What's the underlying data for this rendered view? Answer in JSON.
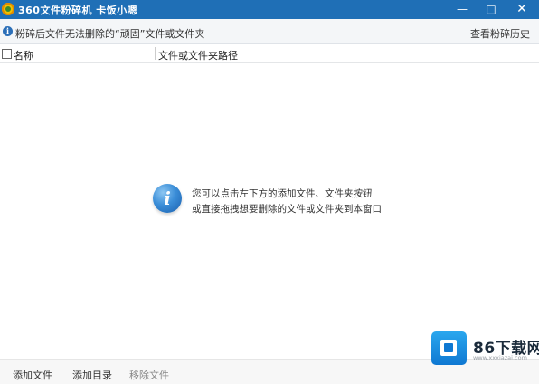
{
  "window": {
    "title": "360文件粉碎机  卡饭小嗯",
    "minimize_glyph": "—",
    "maximize_glyph": "□",
    "close_glyph": "✕",
    "logo_icon": "360-logo-icon"
  },
  "info_bar": {
    "icon": "info-icon",
    "text": "粉碎后文件无法删除的“顽固”文件或文件夹",
    "history_link": "查看粉碎历史"
  },
  "table": {
    "columns": [
      "名称",
      "文件或文件夹路径"
    ],
    "rows": []
  },
  "empty_state": {
    "icon_glyph": "i",
    "line1": "您可以点击左下方的添加文件、文件夹按钮",
    "line2": "或直接拖拽想要删除的文件或文件夹到本窗口"
  },
  "bottom_bar": {
    "add_file": "添加文件",
    "add_dir": "添加目录",
    "remove_file": "移除文件"
  },
  "watermark": {
    "brand": "86下载网",
    "url": "www.xxxiazai.com"
  }
}
